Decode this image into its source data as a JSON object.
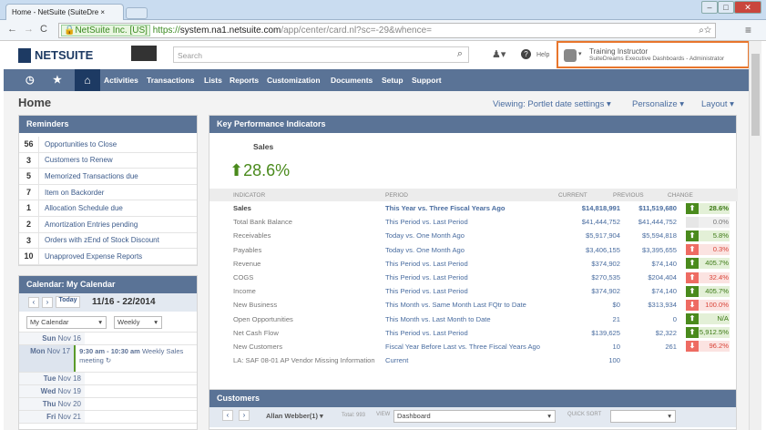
{
  "browser": {
    "tab_title": "Home - NetSuite (SuiteDre",
    "ev_label": "NetSuite Inc. [US]",
    "url_https": "https://",
    "url_host": "system.na1.netsuite.com",
    "url_path": "/app/center/card.nl?sc=-29&whence="
  },
  "header": {
    "logo": "NETSUITE",
    "search_placeholder": "Search",
    "help": "Help",
    "user_name": "Training Instructor",
    "user_role": "SuiteDreams Executive Dashboards - Administrator",
    "accent": "#e8762c"
  },
  "nav": {
    "items": [
      "Activities",
      "Transactions",
      "Lists",
      "Reports",
      "Customization",
      "Documents",
      "Setup",
      "Support"
    ]
  },
  "page": {
    "title": "Home",
    "viewing": "Viewing: Portlet date settings",
    "personalize": "Personalize",
    "layout": "Layout"
  },
  "reminders": {
    "title": "Reminders",
    "items": [
      {
        "n": "56",
        "label": "Opportunities to Close"
      },
      {
        "n": "3",
        "label": "Customers to Renew"
      },
      {
        "n": "5",
        "label": "Memorized Transactions due"
      },
      {
        "n": "7",
        "label": "Item on Backorder"
      },
      {
        "n": "1",
        "label": "Allocation Schedule due"
      },
      {
        "n": "2",
        "label": "Amortization Entries pending"
      },
      {
        "n": "3",
        "label": "Orders with zEnd of Stock Discount"
      },
      {
        "n": "10",
        "label": "Unapproved Expense Reports"
      }
    ]
  },
  "calendar": {
    "title": "Calendar: My Calendar",
    "today": "Today",
    "range": "11/16 - 22/2014",
    "calendar_select": "My Calendar",
    "view_select": "Weekly",
    "days": [
      {
        "dow": "Sun",
        "date": "Nov 16"
      },
      {
        "dow": "Mon",
        "date": "Nov 17",
        "event_time": "9:30 am - 10:30 am",
        "event_title": "Weekly Sales meeting"
      },
      {
        "dow": "Tue",
        "date": "Nov 18"
      },
      {
        "dow": "Wed",
        "date": "Nov 19"
      },
      {
        "dow": "Thu",
        "date": "Nov 20"
      },
      {
        "dow": "Fri",
        "date": "Nov 21"
      }
    ]
  },
  "kpi": {
    "title": "Key Performance Indicators",
    "headline_label": "Sales",
    "headline_value": "28.6%",
    "columns": [
      "INDICATOR",
      "PERIOD",
      "CURRENT",
      "PREVIOUS",
      "CHANGE"
    ],
    "rows": [
      {
        "indicator": "Sales",
        "period": "This Year vs. Three Fiscal Years Ago",
        "current": "$14,818,991",
        "previous": "$11,519,680",
        "change": "28.6%",
        "dir": "up",
        "tone": "good"
      },
      {
        "indicator": "Total Bank Balance",
        "period": "This Period vs. Last Period",
        "current": "$41,444,752",
        "previous": "$41,444,752",
        "change": "0.0%",
        "dir": "none",
        "tone": "neutral"
      },
      {
        "indicator": "Receivables",
        "period": "Today vs. One Month Ago",
        "current": "$5,917,904",
        "previous": "$5,594,818",
        "change": "5.8%",
        "dir": "up",
        "tone": "good"
      },
      {
        "indicator": "Payables",
        "period": "Today vs. One Month Ago",
        "current": "$3,406,155",
        "previous": "$3,395,655",
        "change": "0.3%",
        "dir": "up",
        "tone": "bad"
      },
      {
        "indicator": "Revenue",
        "period": "This Period vs. Last Period",
        "current": "$374,902",
        "previous": "$74,140",
        "change": "405.7%",
        "dir": "up",
        "tone": "good"
      },
      {
        "indicator": "COGS",
        "period": "This Period vs. Last Period",
        "current": "$270,535",
        "previous": "$204,404",
        "change": "32.4%",
        "dir": "up",
        "tone": "bad"
      },
      {
        "indicator": "Income",
        "period": "This Period vs. Last Period",
        "current": "$374,902",
        "previous": "$74,140",
        "change": "405.7%",
        "dir": "up",
        "tone": "good"
      },
      {
        "indicator": "New Business",
        "period": "This Month vs. Same Month Last FQtr to Date",
        "current": "$0",
        "previous": "$313,934",
        "change": "100.0%",
        "dir": "down",
        "tone": "bad"
      },
      {
        "indicator": "Open Opportunities",
        "period": "This Month vs. Last Month to Date",
        "current": "21",
        "previous": "0",
        "change": "N/A",
        "dir": "up",
        "tone": "good"
      },
      {
        "indicator": "Net Cash Flow",
        "period": "This Period vs. Last Period",
        "current": "$139,625",
        "previous": "$2,322",
        "change": "5,912.5%",
        "dir": "up",
        "tone": "good"
      },
      {
        "indicator": "New Customers",
        "period": "Fiscal Year Before Last vs. Three Fiscal Years Ago",
        "current": "10",
        "previous": "261",
        "change": "96.2%",
        "dir": "down",
        "tone": "bad"
      },
      {
        "indicator": "LA: SAF 08-01 AP Vendor Missing Information",
        "period": "Current",
        "current": "100",
        "previous": "",
        "change": "",
        "dir": "",
        "tone": ""
      }
    ]
  },
  "customers": {
    "title": "Customers",
    "owner": "Allan Webber(1)",
    "total": "Total: 993",
    "view_label": "VIEW",
    "view_value": "Dashboard",
    "quicksort_label": "QUICK SORT"
  }
}
